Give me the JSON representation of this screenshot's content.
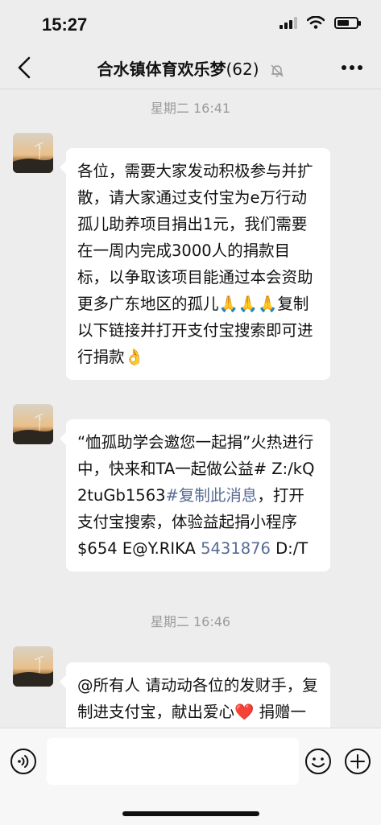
{
  "status_bar": {
    "time": "15:27"
  },
  "nav": {
    "group_name": "合水镇体育欢乐梦",
    "member_count": "(62)"
  },
  "messages": [
    {
      "type": "timestamp",
      "text": "星期二 16:41"
    },
    {
      "type": "message",
      "text": "各位，需要大家发动积极参与并扩散，请大家通过支付宝为e万行动孤儿助养项目捐出1元，我们需要在一周内完成3000人的捐款目标，以争取该项目能通过本会资助更多广东地区的孤儿",
      "emoji_run": "🙏🙏🙏",
      "text_after": "复制以下链接并打开支付宝搜索即可进行捐款",
      "end_emoji": "👌"
    },
    {
      "type": "message",
      "text_a": "“恤孤助学会邀您一起捐”火热进行中，快来和TA一起做公益# Z:/kQ2tuGb1563",
      "link_a": "#复制此消息",
      "text_b": "，打开支付宝搜索，体验益起捐小程序  $654 E@Y.RIKA ",
      "link_b": "5431876",
      "text_c": " D:/T"
    },
    {
      "type": "timestamp",
      "text": "星期二 16:46"
    },
    {
      "type": "message",
      "text": "@所有人 请动动各位的发财手，复制进支付宝，献出爱心",
      "end_emoji": "❤️",
      "text_after": "  捐赠一元"
    }
  ],
  "input": {
    "placeholder": ""
  }
}
